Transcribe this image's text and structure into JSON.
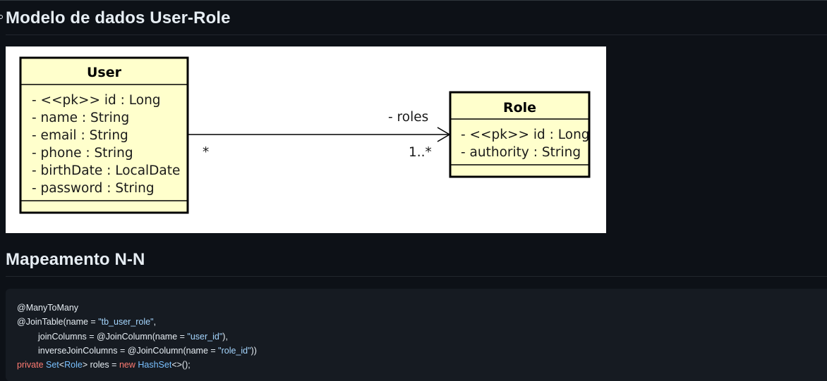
{
  "headings": {
    "model": "Modelo de dados User-Role",
    "mapping": "Mapeamento N-N"
  },
  "diagram": {
    "user": {
      "title": "User",
      "attributes": [
        "- <<pk>> id : Long",
        "- name : String",
        "- email : String",
        "- phone : String",
        "- birthDate : LocalDate",
        "- password : String"
      ]
    },
    "role": {
      "title": "Role",
      "attributes": [
        "- <<pk>> id : Long",
        "- authority : String"
      ]
    },
    "association": {
      "label": "- roles",
      "source_multiplicity": "*",
      "target_multiplicity": "1..*"
    },
    "colors": {
      "class_fill": "#ffffcc",
      "border": "#000000"
    }
  },
  "code": {
    "line1": "@ManyToMany",
    "line2_a": "@JoinTable(name = ",
    "line2_str": "\"tb_user_role\"",
    "line2_b": ",",
    "line3_a": "joinColumns = @JoinColumn(name = ",
    "line3_str": "\"user_id\"",
    "line3_b": "),",
    "line4_a": "inverseJoinColumns = @JoinColumn(name = ",
    "line4_str": "\"role_id\"",
    "line4_b": "))",
    "line5_kw1": "private",
    "line5_type1": "Set",
    "line5_lt": "<",
    "line5_type2": "Role",
    "line5_mid": "> roles = ",
    "line5_kw2": "new",
    "line5_type3": "HashSet",
    "line5_end": "<>();"
  }
}
